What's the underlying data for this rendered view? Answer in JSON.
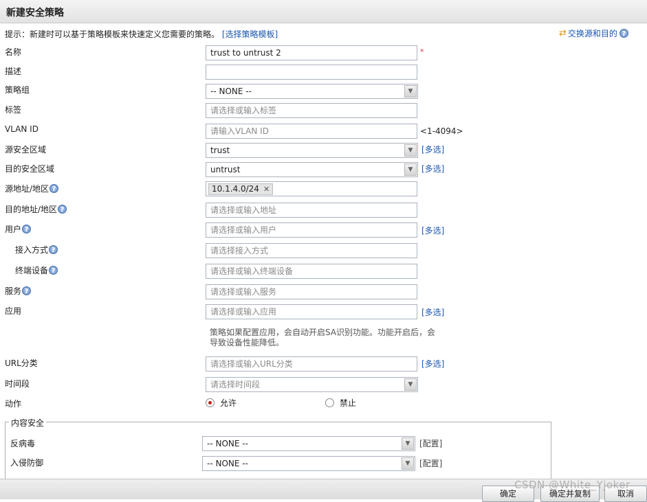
{
  "dialog": {
    "title": "新建安全策略"
  },
  "hint": {
    "text": "提示：新建时可以基于策略模板来快速定义您需要的策略。",
    "link": "[选择策略模板]"
  },
  "swap": {
    "label": "交换源和目的"
  },
  "fields": {
    "name": {
      "label": "名称",
      "value": "trust to untrust 2",
      "required_mark": "*"
    },
    "description": {
      "label": "描述",
      "value": ""
    },
    "policy_group": {
      "label": "策略组",
      "value": "-- NONE --"
    },
    "tag": {
      "label": "标签",
      "placeholder": "请选择或输入标签"
    },
    "vlan": {
      "label": "VLAN ID",
      "placeholder": "请输入VLAN ID",
      "range": "<1-4094>"
    },
    "src_zone": {
      "label": "源安全区域",
      "value": "trust",
      "multi": "[多选]"
    },
    "dst_zone": {
      "label": "目的安全区域",
      "value": "untrust",
      "multi": "[多选]"
    },
    "src_addr": {
      "label": "源地址/地区",
      "tag": "10.1.4.0/24"
    },
    "dst_addr": {
      "label": "目的地址/地区",
      "placeholder": "请选择或输入地址"
    },
    "user": {
      "label": "用户",
      "placeholder": "请选择或输入用户",
      "multi": "[多选]"
    },
    "access": {
      "label": "接入方式",
      "placeholder": "请选择接入方式"
    },
    "terminal": {
      "label": "终端设备",
      "placeholder": "请选择或输入终端设备"
    },
    "service": {
      "label": "服务",
      "placeholder": "请选择或输入服务"
    },
    "application": {
      "label": "应用",
      "placeholder": "请选择或输入应用",
      "multi": "[多选]",
      "note": "策略如果配置应用，会自动开启SA识别功能。功能开启后，会导致设备性能降低。"
    },
    "url": {
      "label": "URL分类",
      "placeholder": "请选择或输入URL分类",
      "multi": "[多选]"
    },
    "schedule": {
      "label": "时间段",
      "placeholder": "请选择时间段"
    },
    "action": {
      "label": "动作",
      "options": [
        "允许",
        "禁止"
      ],
      "selected": "允许"
    }
  },
  "content_security": {
    "legend": "内容安全",
    "antivirus": {
      "label": "反病毒",
      "value": "-- NONE --",
      "config": "[配置]"
    },
    "ips": {
      "label": "入侵防御",
      "value": "-- NONE --",
      "config": "[配置]"
    }
  },
  "buttons": {
    "ok": "确定",
    "ok_copy": "确定并复制",
    "cancel": "取消"
  },
  "watermark": "CSDN @White_Yjoker",
  "colors": {
    "link": "#1a56b0",
    "required": "#e03030",
    "radio_on": "#c0201a"
  },
  "icons": {
    "help": "?",
    "swap": "⇄",
    "dropdown": "▼",
    "remove": "✕"
  }
}
